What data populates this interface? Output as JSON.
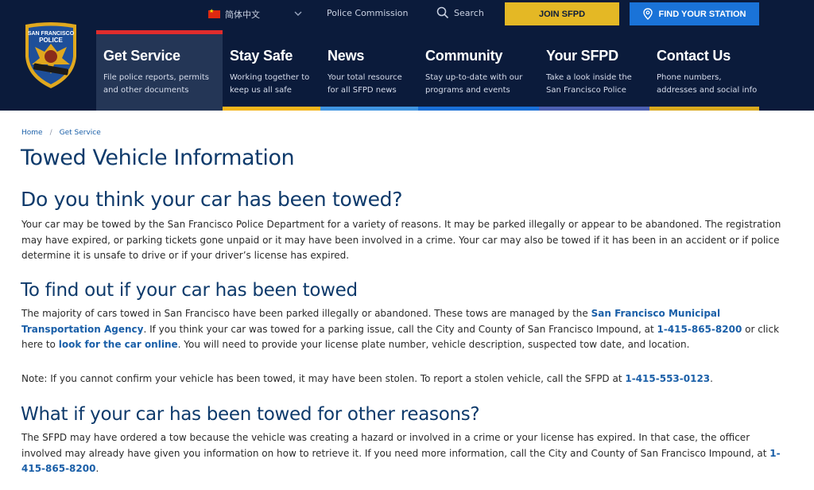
{
  "topbar": {
    "language": "简体中文",
    "police_commission": "Police Commission",
    "search": "Search",
    "join": "JOIN SFPD",
    "find_station": "FIND YOUR STATION"
  },
  "logo": {
    "top_text": "SAN FRANCISCO",
    "mid_text": "POLICE"
  },
  "nav": [
    {
      "title": "Get Service",
      "desc1": "File police reports, permits",
      "desc2": "and other documents",
      "color": "#e02c2c"
    },
    {
      "title": "Stay Safe",
      "desc1": "Working together to",
      "desc2": "keep us all safe",
      "color": "#f2b51c"
    },
    {
      "title": "News",
      "desc1": "Your total resource",
      "desc2": "for all SFPD news",
      "color": "#3f94e0"
    },
    {
      "title": "Community",
      "desc1": "Stay up-to-date with our",
      "desc2": "programs and events",
      "color": "#1a6fd6"
    },
    {
      "title": "Your SFPD",
      "desc1": "Take a look inside the",
      "desc2": "San Francisco Police",
      "color": "#4c5fb1"
    },
    {
      "title": "Contact Us",
      "desc1": "Phone numbers,",
      "desc2": "addresses and social info",
      "color": "#d9a91e"
    }
  ],
  "breadcrumb": {
    "home": "Home",
    "sep": "/",
    "current": "Get Service"
  },
  "page_title": "Towed Vehicle Information",
  "section1": {
    "heading": "Do you think your car has been towed?",
    "body": "Your car may be towed by the San Francisco Police Department for a variety of reasons. It may be parked illegally or appear to be abandoned. The registration may have expired, or parking tickets gone unpaid or it may have been involved in a crime. Your car may also be towed if it has been in an accident or if police determine it is unsafe to drive or if your driver’s license has expired."
  },
  "section2": {
    "heading": "To find out if your car has been towed",
    "p1_a": "The majority of cars towed in San Francisco have been parked illegally or abandoned. These tows are managed by the ",
    "p1_link1": "San Francisco Municipal Transportation Agency",
    "p1_b": ". If you think your car was towed for a parking issue, call the City and County of San Francisco Impound, at ",
    "p1_phone": "1-415-865-8200",
    "p1_c": " or click here to ",
    "p1_link2": "look for the car online",
    "p1_d": ". You will need to provide your license plate number, vehicle description, suspected tow date, and location.",
    "note_a": "Note: If you cannot confirm your vehicle has been towed, it may have been stolen. To report a stolen vehicle, call the SFPD at ",
    "note_phone": "1-415-553-0123",
    "note_b": "."
  },
  "section3": {
    "heading": "What if your car has been towed for other reasons?",
    "body_a": "The SFPD may have ordered a tow because the vehicle was creating a hazard or involved in a crime or your license has expired. In that case, the officer involved may already have given you information on how to retrieve it. If you need more information, call the City and County of San Francisco Impound, at ",
    "body_phone": "1-415-865-8200",
    "body_b": "."
  }
}
